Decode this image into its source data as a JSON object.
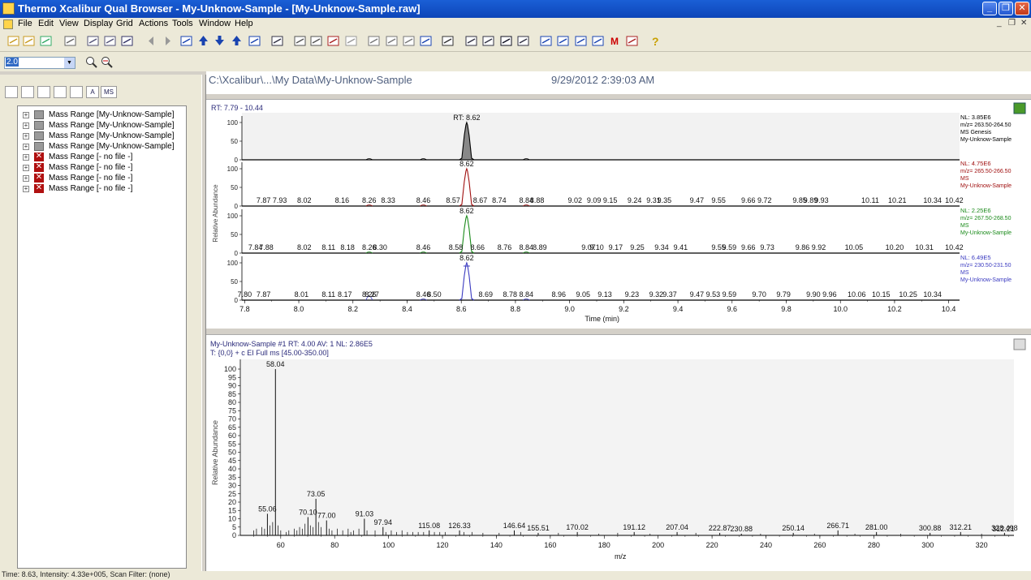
{
  "window": {
    "title": "Thermo Xcalibur Qual Browser - My-Unknow-Sample - [My-Unknow-Sample.raw]",
    "min_glyph": "_",
    "max_glyph": "❐",
    "close_glyph": "✕"
  },
  "menu": [
    "File",
    "Edit",
    "View",
    "Display",
    "Grid",
    "Actions",
    "Tools",
    "Window",
    "Help"
  ],
  "doc_controls": [
    "_",
    "❐",
    "✕"
  ],
  "toolbar_icons": [
    "open-icon",
    "open-folder-icon",
    "save-icon",
    "print-icon",
    "copy-icon",
    "paste-icon",
    "undo-icon",
    "back-arrow-icon",
    "forward-arrow-icon",
    "zoom-reset-icon",
    "up-arrow-icon",
    "down-arrow-icon",
    "updown-arrow-icon",
    "zoom-fit-icon",
    "display-options-icon",
    "grid-insert-icon",
    "grid-insert2-icon",
    "grid-delete-icon",
    "grid-cut-icon",
    "grid-layout-icon",
    "grid-layout2-icon",
    "grid-layout3-icon",
    "grid-layout4-icon",
    "labels-icon",
    "chromatogram-icon",
    "spectrum-icon",
    "map-icon",
    "list-icon",
    "peak-detect-icon",
    "peak-detect2-icon",
    "peak-add-icon",
    "peak-remove-icon",
    "mass-tag-icon",
    "library-search-icon",
    "help-icon"
  ],
  "zoom_select": {
    "value": "2.0"
  },
  "left_tabs": [
    "icon",
    "doc",
    "xp",
    "sub",
    "ab",
    "A",
    "MS"
  ],
  "tree": [
    {
      "label": "Mass Range [My-Unknow-Sample]",
      "ok": true
    },
    {
      "label": "Mass Range [My-Unknow-Sample]",
      "ok": true
    },
    {
      "label": "Mass Range [My-Unknow-Sample]",
      "ok": true
    },
    {
      "label": "Mass Range [My-Unknow-Sample]",
      "ok": true
    },
    {
      "label": "Mass Range [- no file -]",
      "ok": false
    },
    {
      "label": "Mass Range [- no file -]",
      "ok": false
    },
    {
      "label": "Mass Range [- no file -]",
      "ok": false
    },
    {
      "label": "Mass Range [- no file -]",
      "ok": false
    }
  ],
  "header": {
    "path": "C:\\Xcalibur\\...\\My Data\\My-Unknow-Sample",
    "datetime": "9/29/2012 2:39:03 AM"
  },
  "chart_data": [
    {
      "type": "line",
      "title": "RT: 7.79 - 10.44",
      "xlabel": "Time (min)",
      "ylabel": "Relative Abundance",
      "xlim": [
        7.79,
        10.44
      ],
      "xticks": [
        7.8,
        8.0,
        8.2,
        8.4,
        8.6,
        8.8,
        9.0,
        9.2,
        9.4,
        9.6,
        9.8,
        10.0,
        10.2,
        10.4
      ],
      "yticks": [
        0,
        50,
        100
      ],
      "panels": [
        {
          "name": "m/z= 263.50-264.50",
          "color": "#000000",
          "filled": true,
          "info": [
            "NL: 3.85E6",
            "m/z= 263.50-264.50",
            "MS Genesis",
            "My-Unknow-Sample"
          ],
          "peak_label": "RT: 8.62",
          "peak": {
            "rt": 8.62,
            "height": 100
          },
          "labels": []
        },
        {
          "name": "m/z= 265.50-266.50",
          "color": "#a01010",
          "info": [
            "NL: 4.75E6",
            "m/z= 265.50-266.50",
            "MS",
            "My-Unknow-Sample"
          ],
          "peak_label": "8.62",
          "peak": {
            "rt": 8.62,
            "height": 100
          },
          "labels": [
            "7.87",
            "7.93",
            "8.02",
            "8.16",
            "8.26",
            "8.33",
            "8.46",
            "8.57",
            "8.67",
            "8.74",
            "8.84",
            "8.88",
            "9.02",
            "9.09",
            "9.15",
            "9.24",
            "9.31",
            "9.35",
            "9.47",
            "9.55",
            "9.66",
            "9.72",
            "9.85",
            "9.89",
            "9.93",
            "10.11",
            "10.21",
            "10.34",
            "10.42"
          ]
        },
        {
          "name": "m/z= 267.50-268.50",
          "color": "#1a8a1a",
          "info": [
            "NL: 2.25E6",
            "m/z= 267.50-268.50",
            "MS",
            "My-Unknow-Sample"
          ],
          "peak_label": "8.62",
          "peak": {
            "rt": 8.62,
            "height": 100
          },
          "labels": [
            "7.84",
            "7.88",
            "8.02",
            "8.11",
            "8.18",
            "8.26",
            "8.30",
            "8.46",
            "8.58",
            "8.66",
            "8.76",
            "8.84",
            "8.89",
            "9.07",
            "9.10",
            "9.17",
            "9.25",
            "9.34",
            "9.41",
            "9.55",
            "9.59",
            "9.66",
            "9.73",
            "9.86",
            "9.92",
            "10.05",
            "10.20",
            "10.31",
            "10.42"
          ]
        },
        {
          "name": "m/z= 230.50-231.50",
          "color": "#3a3ac0",
          "info": [
            "NL: 6.49E5",
            "m/z= 230.50-231.50",
            "MS",
            "My-Unknow-Sample"
          ],
          "peak_label": "8.62",
          "peak": {
            "rt": 8.62,
            "height": 100
          },
          "labels": [
            "7.80",
            "7.87",
            "8.01",
            "8.11",
            "8.17",
            "8.26",
            "8.27",
            "8.46",
            "8.50",
            "8.69",
            "8.78",
            "8.84",
            "8.96",
            "9.05",
            "9.13",
            "9.23",
            "9.32",
            "9.37",
            "9.47",
            "9.53",
            "9.59",
            "9.70",
            "9.79",
            "9.90",
            "9.96",
            "10.06",
            "10.15",
            "10.25",
            "10.34"
          ]
        }
      ]
    },
    {
      "type": "bar",
      "title": "My-Unknow-Sample #1  RT: 4.00  AV: 1  NL: 2.86E5",
      "subtitle": "T: {0,0} + c EI Full ms [45.00-350.00]",
      "xlabel": "m/z",
      "ylabel": "Relative Abundance",
      "xlim": [
        45,
        332
      ],
      "ylim": [
        0,
        100
      ],
      "xticks": [
        60,
        80,
        100,
        120,
        140,
        160,
        180,
        200,
        220,
        240,
        260,
        280,
        300,
        320
      ],
      "yticks": [
        0,
        5,
        10,
        15,
        20,
        25,
        30,
        35,
        40,
        45,
        50,
        55,
        60,
        65,
        70,
        75,
        80,
        85,
        90,
        95,
        100
      ],
      "labeled_peaks": [
        {
          "x": 55.06,
          "y": 13,
          "label": "55.06"
        },
        {
          "x": 58.04,
          "y": 100,
          "label": "58.04"
        },
        {
          "x": 70.1,
          "y": 11,
          "label": "70.10"
        },
        {
          "x": 73.05,
          "y": 22,
          "label": "73.05"
        },
        {
          "x": 77.0,
          "y": 9,
          "label": "77.00"
        },
        {
          "x": 91.03,
          "y": 10,
          "label": "91.03"
        },
        {
          "x": 97.94,
          "y": 5,
          "label": "97.94"
        },
        {
          "x": 115.08,
          "y": 3,
          "label": "115.08"
        },
        {
          "x": 126.33,
          "y": 3,
          "label": "126.33"
        },
        {
          "x": 146.64,
          "y": 3,
          "label": "146.64"
        },
        {
          "x": 155.51,
          "y": 1.5,
          "label": "155.51"
        },
        {
          "x": 170.02,
          "y": 2,
          "label": "170.02"
        },
        {
          "x": 191.12,
          "y": 2,
          "label": "191.12"
        },
        {
          "x": 207.04,
          "y": 2,
          "label": "207.04"
        },
        {
          "x": 222.87,
          "y": 1.5,
          "label": "222.87"
        },
        {
          "x": 230.88,
          "y": 1,
          "label": "230.88"
        },
        {
          "x": 250.14,
          "y": 1.5,
          "label": "250.14"
        },
        {
          "x": 266.71,
          "y": 3,
          "label": "266.71"
        },
        {
          "x": 281.0,
          "y": 2,
          "label": "281.00"
        },
        {
          "x": 300.88,
          "y": 1.5,
          "label": "300.88"
        },
        {
          "x": 312.21,
          "y": 2,
          "label": "312.21"
        },
        {
          "x": 328.498,
          "y": 1.5,
          "label": "328.498"
        }
      ],
      "minor_peaks": [
        {
          "x": 50,
          "y": 3
        },
        {
          "x": 51,
          "y": 4
        },
        {
          "x": 53,
          "y": 5
        },
        {
          "x": 54,
          "y": 4
        },
        {
          "x": 56,
          "y": 6
        },
        {
          "x": 57,
          "y": 8
        },
        {
          "x": 59,
          "y": 6
        },
        {
          "x": 60,
          "y": 3
        },
        {
          "x": 62,
          "y": 2
        },
        {
          "x": 63,
          "y": 3
        },
        {
          "x": 65,
          "y": 4
        },
        {
          "x": 66,
          "y": 3
        },
        {
          "x": 67,
          "y": 5
        },
        {
          "x": 68,
          "y": 4
        },
        {
          "x": 69,
          "y": 7
        },
        {
          "x": 71,
          "y": 6
        },
        {
          "x": 72,
          "y": 5
        },
        {
          "x": 74,
          "y": 8
        },
        {
          "x": 75,
          "y": 5
        },
        {
          "x": 78,
          "y": 4
        },
        {
          "x": 79,
          "y": 3
        },
        {
          "x": 81,
          "y": 4
        },
        {
          "x": 83,
          "y": 3
        },
        {
          "x": 85,
          "y": 4
        },
        {
          "x": 86,
          "y": 2
        },
        {
          "x": 87,
          "y": 3
        },
        {
          "x": 89,
          "y": 4
        },
        {
          "x": 92,
          "y": 3
        },
        {
          "x": 95,
          "y": 3
        },
        {
          "x": 99,
          "y": 2
        },
        {
          "x": 101,
          "y": 3
        },
        {
          "x": 103,
          "y": 2
        },
        {
          "x": 105,
          "y": 3
        },
        {
          "x": 107,
          "y": 2
        },
        {
          "x": 109,
          "y": 2
        },
        {
          "x": 111,
          "y": 2
        },
        {
          "x": 113,
          "y": 2
        },
        {
          "x": 117,
          "y": 2
        },
        {
          "x": 119,
          "y": 2
        },
        {
          "x": 121,
          "y": 2
        },
        {
          "x": 128,
          "y": 2
        },
        {
          "x": 131,
          "y": 2
        },
        {
          "x": 135,
          "y": 1.5
        },
        {
          "x": 141,
          "y": 1.5
        },
        {
          "x": 149,
          "y": 2
        },
        {
          "x": 163,
          "y": 1.5
        },
        {
          "x": 178,
          "y": 1
        },
        {
          "x": 185,
          "y": 1.5
        },
        {
          "x": 197,
          "y": 1
        },
        {
          "x": 214,
          "y": 1.5
        },
        {
          "x": 238,
          "y": 1
        },
        {
          "x": 258,
          "y": 1
        },
        {
          "x": 273,
          "y": 1
        },
        {
          "x": 290,
          "y": 1
        },
        {
          "x": 320,
          "y": 1
        }
      ],
      "right_label": "312.21"
    }
  ],
  "status": "Time: 8.63, Intensity: 4.33e+005, Scan Filter: (none)"
}
